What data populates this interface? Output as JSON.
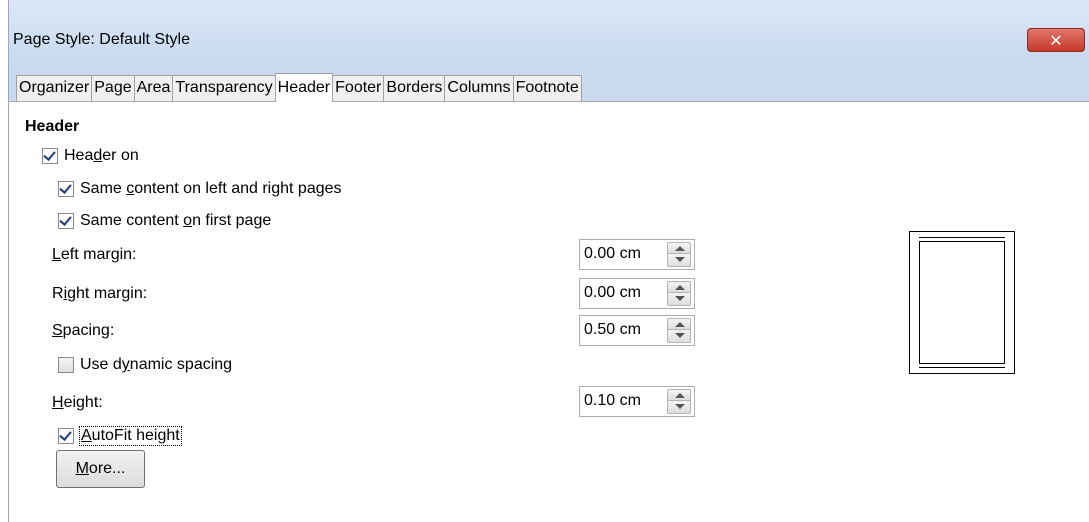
{
  "window": {
    "title": "Page Style: Default Style",
    "close_symbol": "✕"
  },
  "tabs": [
    {
      "label": "Organizer",
      "active": false
    },
    {
      "label": "Page",
      "active": false
    },
    {
      "label": "Area",
      "active": false
    },
    {
      "label": "Transparency",
      "active": false
    },
    {
      "label": "Header",
      "active": true
    },
    {
      "label": "Footer",
      "active": false
    },
    {
      "label": "Borders",
      "active": false
    },
    {
      "label": "Columns",
      "active": false
    },
    {
      "label": "Footnote",
      "active": false
    }
  ],
  "header_section": {
    "title": "Header",
    "header_on": {
      "pre": "Hea",
      "accel": "d",
      "post": "er on",
      "checked": true
    },
    "same_lr": {
      "pre": "Same ",
      "accel": "c",
      "post": "ontent on left and right pages",
      "checked": true
    },
    "same_first": {
      "pre": "Same content ",
      "accel": "o",
      "post": "n first page",
      "checked": true
    },
    "left_margin": {
      "pre": "",
      "accel": "L",
      "post": "eft margin:",
      "value": "0.00 cm"
    },
    "right_margin": {
      "pre": "R",
      "accel": "i",
      "post": "ght margin:",
      "value": "0.00 cm"
    },
    "spacing": {
      "pre": "",
      "accel": "S",
      "post": "pacing:",
      "value": "0.50 cm"
    },
    "dynamic_spacing": {
      "pre": "Use d",
      "accel": "y",
      "post": "namic spacing",
      "checked": false
    },
    "height": {
      "pre": "",
      "accel": "H",
      "post": "eight:",
      "value": "0.10 cm"
    },
    "autofit": {
      "pre": "",
      "accel": "A",
      "post": "utoFit height",
      "checked": true
    },
    "more_button": {
      "pre": "",
      "accel": "M",
      "post": "ore..."
    }
  },
  "colors": {
    "titlebar": "#c9daf0",
    "close_button": "#c7392b",
    "checkmark": "#1f3b7a"
  }
}
